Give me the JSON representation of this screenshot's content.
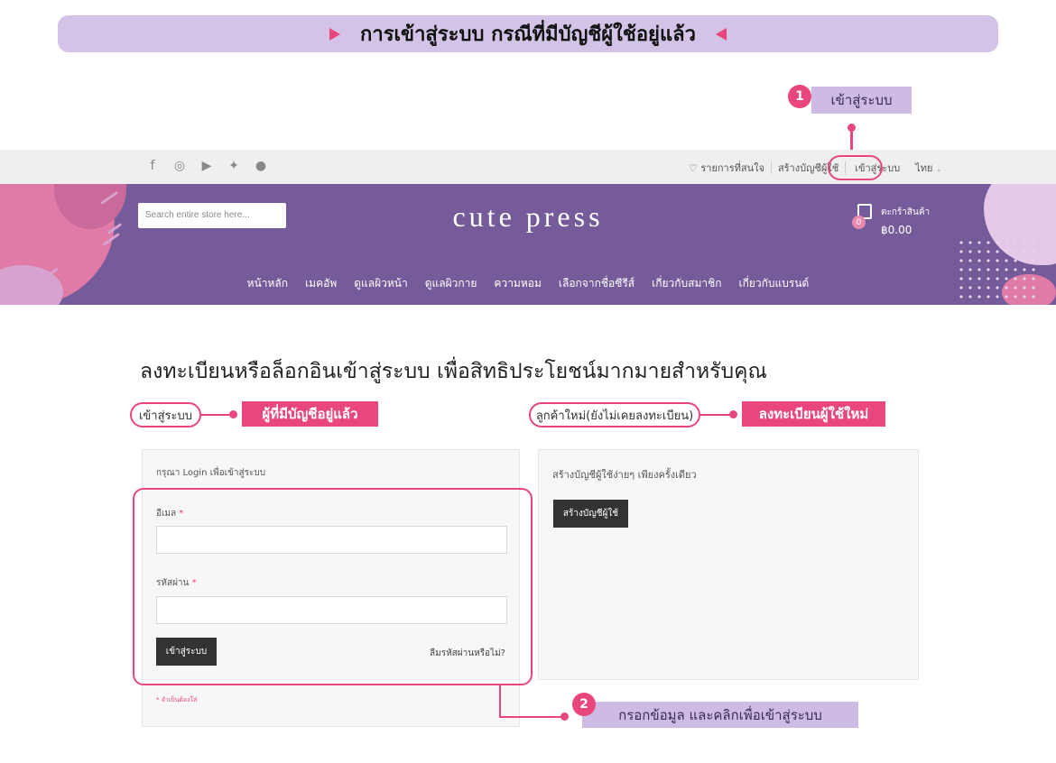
{
  "banner": {
    "text": "การเข้าสู่ระบบ กรณีที่มีบัญชีผู้ใช้อยู่แล้ว"
  },
  "callouts": {
    "step1": {
      "number": "1",
      "label": "เข้าสู่ระบบ"
    },
    "step2": {
      "number": "2",
      "label": "กรอกข้อมูล และคลิกเพื่อเข้าสู่ระบบ"
    },
    "existing_account": "ผู้ที่มีบัญชีอยู่แล้ว",
    "register_new": "ลงทะเบียนผู้ใช้ใหม่"
  },
  "utilbar": {
    "social_icons": [
      "facebook-icon",
      "instagram-icon",
      "youtube-icon",
      "twitter-icon",
      "line-icon"
    ],
    "wishlist": "รายการที่สนใจ",
    "create_account": "สร้างบัญชีผู้ใช้",
    "login": "เข้าสู่ระบบ",
    "language": "ไทย"
  },
  "header": {
    "search_placeholder": "Search entire store here...",
    "logo": "cute press",
    "cart_label": "ตะกร้าสินค้า",
    "cart_count": "0",
    "cart_total": "฿0.00",
    "nav": [
      "หน้าหลัก",
      "เมคอัพ",
      "ดูแลผิวหน้า",
      "ดูแลผิวกาย",
      "ความหอม",
      "เลือกจากชื่อซีรีส์",
      "เกี่ยวกับสมาชิก",
      "เกี่ยวกับแบรนด์"
    ]
  },
  "page": {
    "title": "ลงทะเบียนหรือล็อกอินเข้าสู่ระบบ เพื่อสิทธิประโยชน์มากมายสำหรับคุณ",
    "login_section": "เข้าสู่ระบบ",
    "new_customer_section": "ลูกค้าใหม่(ยังไม่เคยลงทะเบียน)"
  },
  "login_form": {
    "intro": "กรุณา Login เพื่อเข้าสู่ระบบ",
    "email_label": "อีเมล",
    "password_label": "รหัสผ่าน",
    "required_mark": "*",
    "email_value": "",
    "password_value": "",
    "submit": "เข้าสู่ระบบ",
    "forgot": "ลืมรหัสผ่านหรือไม่?",
    "required_note": "* จำเป็นต้องใส่"
  },
  "register_panel": {
    "intro": "สร้างบัญชีผู้ใช้ง่ายๆ เพียงครั้งเดียว",
    "button": "สร้างบัญชีผู้ใช้"
  },
  "colors": {
    "accent_pink": "#e8467c",
    "brand_purple": "#755b9a",
    "banner_lilac": "#d3c3e7",
    "button_dark": "#333333"
  }
}
